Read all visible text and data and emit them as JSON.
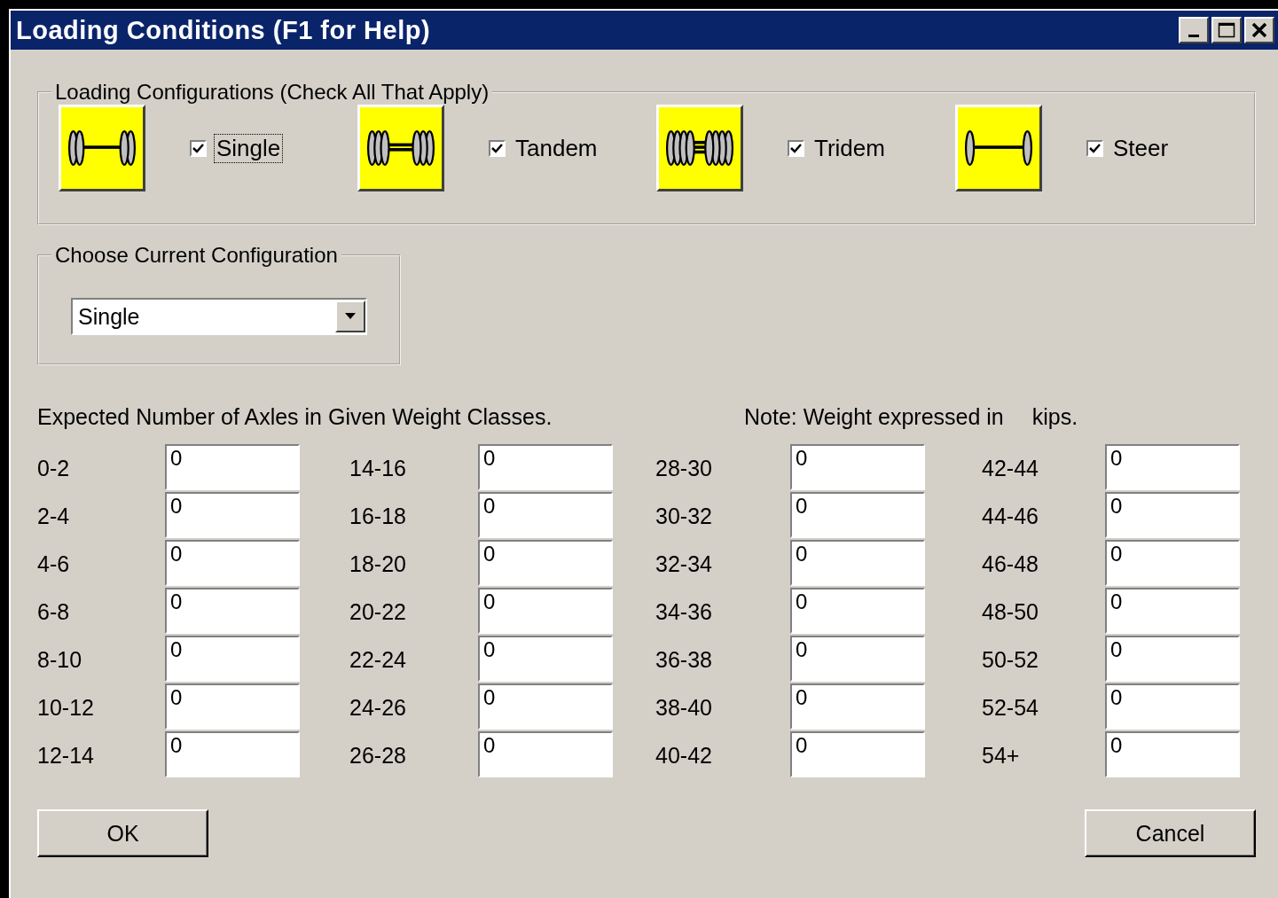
{
  "window": {
    "title": "Loading Conditions (F1 for Help)"
  },
  "configurations": {
    "legend": "Loading Configurations (Check All That Apply)",
    "items": [
      {
        "kind": "single",
        "label": "Single",
        "checked": true,
        "focused": true
      },
      {
        "kind": "tandem",
        "label": "Tandem",
        "checked": true,
        "focused": false
      },
      {
        "kind": "tridem",
        "label": "Tridem",
        "checked": true,
        "focused": false
      },
      {
        "kind": "steer",
        "label": "Steer",
        "checked": true,
        "focused": false
      }
    ]
  },
  "current": {
    "legend": "Choose Current Configuration",
    "value": "Single"
  },
  "weights": {
    "heading": "Expected Number of Axles in Given Weight Classes.",
    "note": "Note:  Weight expressed in",
    "unit": "kips.",
    "columns": [
      [
        {
          "label": "0-2",
          "value": "0"
        },
        {
          "label": "2-4",
          "value": "0"
        },
        {
          "label": "4-6",
          "value": "0"
        },
        {
          "label": "6-8",
          "value": "0"
        },
        {
          "label": "8-10",
          "value": "0"
        },
        {
          "label": "10-12",
          "value": "0"
        },
        {
          "label": "12-14",
          "value": "0"
        }
      ],
      [
        {
          "label": "14-16",
          "value": "0"
        },
        {
          "label": "16-18",
          "value": "0"
        },
        {
          "label": "18-20",
          "value": "0"
        },
        {
          "label": "20-22",
          "value": "0"
        },
        {
          "label": "22-24",
          "value": "0"
        },
        {
          "label": "24-26",
          "value": "0"
        },
        {
          "label": "26-28",
          "value": "0"
        }
      ],
      [
        {
          "label": "28-30",
          "value": "0"
        },
        {
          "label": "30-32",
          "value": "0"
        },
        {
          "label": "32-34",
          "value": "0"
        },
        {
          "label": "34-36",
          "value": "0"
        },
        {
          "label": "36-38",
          "value": "0"
        },
        {
          "label": "38-40",
          "value": "0"
        },
        {
          "label": "40-42",
          "value": "0"
        }
      ],
      [
        {
          "label": "42-44",
          "value": "0"
        },
        {
          "label": "44-46",
          "value": "0"
        },
        {
          "label": "46-48",
          "value": "0"
        },
        {
          "label": "48-50",
          "value": "0"
        },
        {
          "label": "50-52",
          "value": "0"
        },
        {
          "label": "52-54",
          "value": "0"
        },
        {
          "label": "54+",
          "value": "0"
        }
      ]
    ]
  },
  "buttons": [
    "OK",
    "Cancel"
  ]
}
